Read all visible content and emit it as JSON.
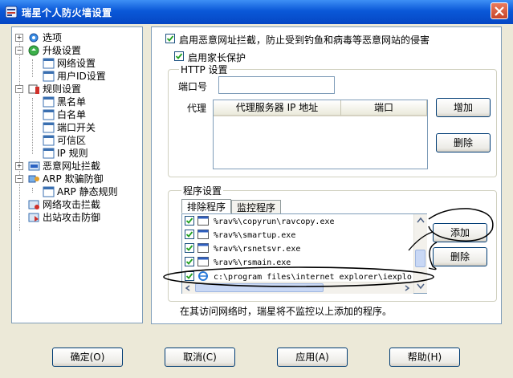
{
  "window": {
    "title": "瑞星个人防火墙设置",
    "icon": "shield-app-icon"
  },
  "tree": [
    {
      "label": "选项",
      "icon": "options-icon"
    },
    {
      "label": "升级设置",
      "icon": "update-icon"
    },
    {
      "label": "网络设置",
      "icon": "doc-icon"
    },
    {
      "label": "用户ID设置",
      "icon": "doc-icon"
    },
    {
      "label": "规则设置",
      "icon": "rules-icon"
    },
    {
      "label": "黑名单",
      "icon": "doc-icon"
    },
    {
      "label": "白名单",
      "icon": "doc-icon"
    },
    {
      "label": "端口开关",
      "icon": "doc-icon"
    },
    {
      "label": "可信区",
      "icon": "doc-icon"
    },
    {
      "label": "IP 规则",
      "icon": "doc-icon"
    },
    {
      "label": "恶意网址拦截",
      "icon": "block-url-icon"
    },
    {
      "label": "ARP 欺骗防御",
      "icon": "arp-icon"
    },
    {
      "label": "ARP 静态规则",
      "icon": "doc-icon"
    },
    {
      "label": "网络攻击拦截",
      "icon": "attack-icon"
    },
    {
      "label": "出站攻击防御",
      "icon": "outbound-icon"
    }
  ],
  "panel": {
    "enable_block_label": "启用恶意网址拦截，防止受到钓鱼和病毒等恶意网站的侵害",
    "enable_parent_label": "启用家长保护",
    "http": {
      "title": "HTTP 设置",
      "port_label": "端口号",
      "port_value": "",
      "proxy_label": "代理",
      "col_server": "代理服务器 IP 地址",
      "col_port": "端口",
      "add_label": "增加",
      "delete_label": "删除"
    },
    "programs": {
      "title": "程序设置",
      "tab_excluded": "排除程序",
      "tab_monitored": "监控程序",
      "items": [
        "%rav%\\copyrun\\ravcopy.exe",
        "%rav%\\smartup.exe",
        "%rav%\\rsnetsvr.exe",
        "%rav%\\rsmain.exe",
        "c:\\program files\\internet explorer\\iexplo"
      ],
      "add_label": "添加",
      "delete_label": "删除",
      "note": "在其访问网络时，瑞星将不监控以上添加的程序。"
    }
  },
  "buttons": {
    "ok": "确定(O)",
    "cancel": "取消(C)",
    "apply": "应用(A)",
    "help": "帮助(H)"
  },
  "colors": {
    "titlebar": "#0a58d8",
    "check": "#21a121",
    "border": "#7f9db9"
  }
}
